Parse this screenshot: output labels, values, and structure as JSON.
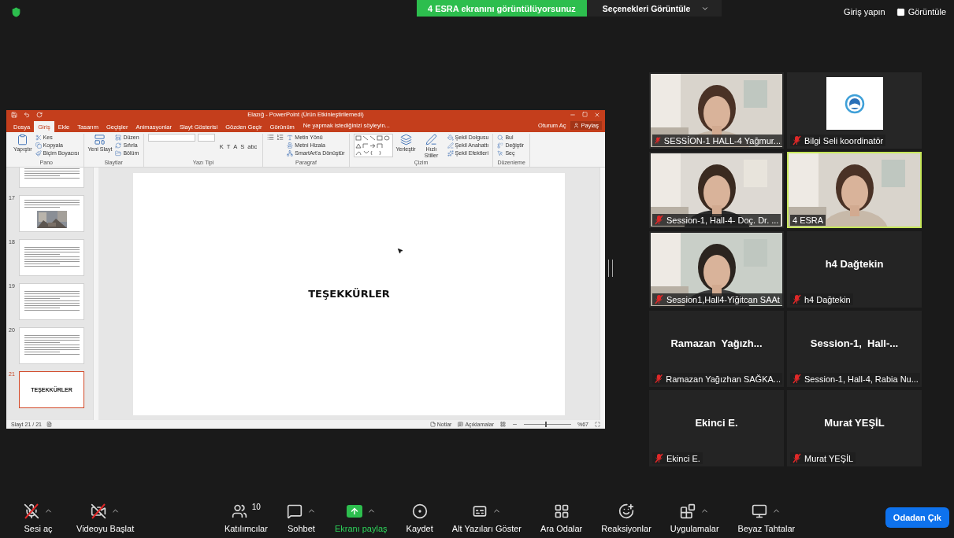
{
  "top_bar": {
    "share_banner": "4 ESRA ekranını görüntülüyorsunuz",
    "options_button": "Seçenekleri Görüntüle",
    "sign_in": "Giriş yapın",
    "view_button": "Görüntüle"
  },
  "shared_screen": {
    "title": "Elazığ - PowerPoint (Ürün Etkinleştirilemedi)",
    "tabs": [
      {
        "label": "Dosya",
        "selected": false
      },
      {
        "label": "Giriş",
        "selected": true
      },
      {
        "label": "Ekle",
        "selected": false
      },
      {
        "label": "Tasarım",
        "selected": false
      },
      {
        "label": "Geçişler",
        "selected": false
      },
      {
        "label": "Animasyonlar",
        "selected": false
      },
      {
        "label": "Slayt Gösterisi",
        "selected": false
      },
      {
        "label": "Gözden Geçir",
        "selected": false
      },
      {
        "label": "Görünüm",
        "selected": false
      }
    ],
    "tell_me": "Ne yapmak istediğinizi söyleyin...",
    "sign_in": "Oturum Aç",
    "share": "Paylaş",
    "ribbon_groups": [
      {
        "label": "Pano",
        "items": [
          {
            "kind": "large",
            "label": "Yapıştır"
          },
          {
            "kind": "small",
            "label": "Kes"
          },
          {
            "kind": "small",
            "label": "Kopyala"
          },
          {
            "kind": "small",
            "label": "Biçim Boyacısı"
          }
        ]
      },
      {
        "label": "Slaytlar",
        "items": [
          {
            "kind": "large",
            "label": "Yeni Slayt"
          },
          {
            "kind": "small",
            "label": "Düzen"
          },
          {
            "kind": "small",
            "label": "Sıfırla"
          },
          {
            "kind": "small",
            "label": "Bölüm"
          }
        ]
      },
      {
        "label": "Yazı Tipi",
        "items": [
          {
            "kind": "font"
          },
          {
            "kind": "format",
            "labels": [
              "K",
              "T",
              "A",
              "S",
              "abc"
            ]
          }
        ]
      },
      {
        "label": "Paragraf",
        "items": [
          {
            "kind": "list"
          },
          {
            "kind": "small",
            "label": "Metin Yönü"
          },
          {
            "kind": "small",
            "label": "Metni Hizala"
          },
          {
            "kind": "small",
            "label": "SmartArt'a Dönüştür"
          }
        ]
      },
      {
        "label": "Çizim",
        "items": [
          {
            "kind": "shapes"
          },
          {
            "kind": "large",
            "label": "Yerleştir"
          },
          {
            "kind": "large",
            "label": "Hızlı Stiller"
          },
          {
            "kind": "small",
            "label": "Şekil Dolgusu"
          },
          {
            "kind": "small",
            "label": "Şekil Anahattı"
          },
          {
            "kind": "small",
            "label": "Şekil Efektleri"
          }
        ]
      },
      {
        "label": "Düzenleme",
        "items": [
          {
            "kind": "small",
            "label": "Bul"
          },
          {
            "kind": "small",
            "label": "Değiştir"
          },
          {
            "kind": "small",
            "label": "Seç"
          }
        ]
      }
    ],
    "slides": [
      {
        "kind": "text",
        "selected": false
      },
      {
        "number": "17",
        "selected": false
      },
      {
        "number": "18",
        "kind": "text",
        "selected": false
      },
      {
        "number": "19",
        "kind": "text",
        "selected": false
      },
      {
        "number": "20",
        "kind": "text",
        "selected": false
      },
      {
        "number": "21",
        "kind": "title",
        "title": "TEŞEKKÜRLER",
        "selected": true
      }
    ],
    "slide_text": "TEŞEKKÜRLER",
    "status": {
      "slide_counter": "Slayt 21 / 21",
      "notes": "Notlar",
      "comments": "Açıklamalar",
      "zoom_slider": {
        "level": 0.45
      },
      "zoom": "%67"
    }
  },
  "participants": [
    {
      "name": "SESSİON-1 HALL-4 Yağmur...",
      "kind": "video",
      "muted": true,
      "speaker": false
    },
    {
      "name": "Bilgi Seli koordinatör",
      "kind": "logo",
      "muted": true,
      "speaker": false
    },
    {
      "name": "Session-1, Hall-4- Doç. Dr. ...",
      "kind": "video",
      "muted": true,
      "speaker": false
    },
    {
      "name": "4 ESRA",
      "kind": "video",
      "muted": false,
      "speaker": true
    },
    {
      "name": "Session1,Hall4-Yiğitcan SAAt",
      "kind": "video",
      "muted": true,
      "speaker": false
    },
    {
      "name": "h4 Dağtekin",
      "display_name": "h4 Dağtekin",
      "kind": "name",
      "muted": true,
      "speaker": false
    },
    {
      "name": "Ramazan Yağızhan SAĞKA...",
      "display_name": "Ramazan  Yağızh...",
      "kind": "name",
      "muted": true,
      "speaker": false
    },
    {
      "name": "Session-1, Hall-4, Rabia Nu...",
      "display_name": "Session-1,  Hall-...",
      "kind": "name",
      "muted": true,
      "speaker": false
    },
    {
      "name": "Ekinci E.",
      "display_name": "Ekinci E.",
      "kind": "name",
      "muted": true,
      "speaker": false
    },
    {
      "name": "Murat YEŞİL",
      "display_name": "Murat YEŞİL",
      "kind": "name",
      "muted": true,
      "speaker": false
    }
  ],
  "toolbar": {
    "left": [
      {
        "label": "Sesi aç",
        "off": true,
        "caret": true
      },
      {
        "label": "Videoyu Başlat",
        "off": true,
        "caret": true
      }
    ],
    "center": [
      {
        "label": "Katılımcılar",
        "count": "10",
        "caret": false
      },
      {
        "label": "Sohbet",
        "caret": true
      },
      {
        "label": "Ekranı paylaş",
        "caret": true
      },
      {
        "label": "Kaydet",
        "caret": false
      },
      {
        "label": "Alt Yazıları Göster",
        "caret": true
      },
      {
        "label": "Ara Odalar",
        "caret": false
      },
      {
        "label": "Reaksiyonlar",
        "caret": false
      },
      {
        "label": "Uygulamalar",
        "caret": true
      },
      {
        "label": "Beyaz Tahtalar",
        "caret": true
      }
    ],
    "leave_button": "Odadan Çık"
  }
}
